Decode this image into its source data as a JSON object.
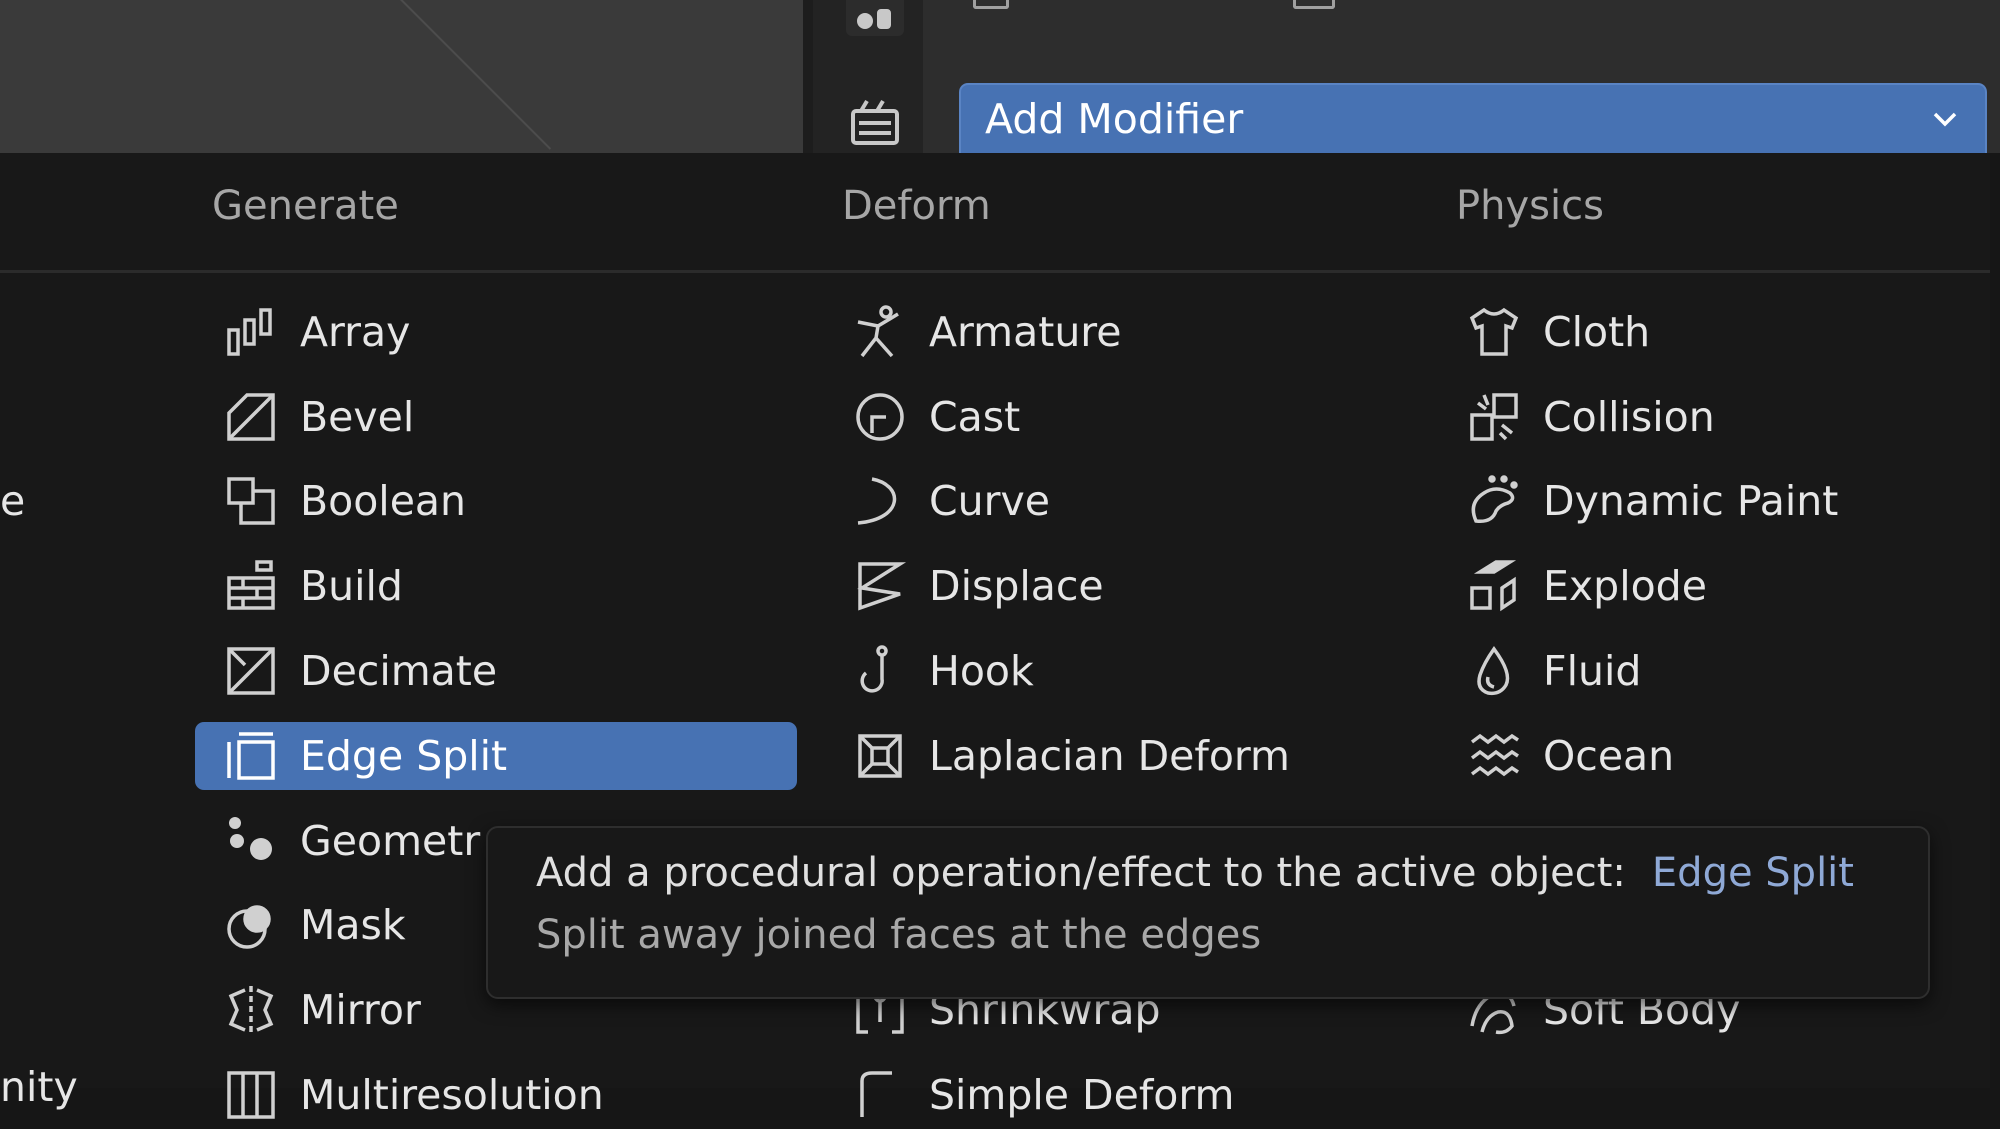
{
  "properties": {
    "add_modifier_label": "Add Modifier"
  },
  "menu": {
    "columns": [
      {
        "heading": "Generate",
        "items": [
          {
            "label": "Array",
            "icon": "array-icon"
          },
          {
            "label": "Bevel",
            "icon": "bevel-icon"
          },
          {
            "label": "Boolean",
            "icon": "boolean-icon"
          },
          {
            "label": "Build",
            "icon": "build-icon"
          },
          {
            "label": "Decimate",
            "icon": "decimate-icon"
          },
          {
            "label": "Edge Split",
            "icon": "edge-split-icon",
            "selected": true
          },
          {
            "label": "Geometr",
            "icon": "geometry-nodes-icon"
          },
          {
            "label": "Mask",
            "icon": "mask-icon"
          },
          {
            "label": "Mirror",
            "icon": "mirror-icon"
          },
          {
            "label": "Multiresolution",
            "icon": "multiresolution-icon"
          }
        ]
      },
      {
        "heading": "Deform",
        "items": [
          {
            "label": "Armature",
            "icon": "armature-icon"
          },
          {
            "label": "Cast",
            "icon": "cast-icon"
          },
          {
            "label": "Curve",
            "icon": "curve-icon"
          },
          {
            "label": "Displace",
            "icon": "displace-icon"
          },
          {
            "label": "Hook",
            "icon": "hook-icon"
          },
          {
            "label": "Laplacian Deform",
            "icon": "laplacian-deform-icon"
          },
          {
            "label": "Shrinkwrap",
            "icon": "shrinkwrap-icon"
          },
          {
            "label": "Simple Deform",
            "icon": "simple-deform-icon"
          }
        ]
      },
      {
        "heading": "Physics",
        "items": [
          {
            "label": "Cloth",
            "icon": "cloth-icon"
          },
          {
            "label": "Collision",
            "icon": "collision-icon"
          },
          {
            "label": "Dynamic Paint",
            "icon": "dynamic-paint-icon"
          },
          {
            "label": "Explode",
            "icon": "explode-icon"
          },
          {
            "label": "Fluid",
            "icon": "fluid-icon"
          },
          {
            "label": "Ocean",
            "icon": "ocean-icon"
          },
          {
            "label": "Soft Body",
            "icon": "soft-body-icon"
          }
        ]
      }
    ],
    "left_fragments": [
      "e",
      "nity"
    ]
  },
  "tooltip": {
    "description": "Add a procedural operation/effect to the active object:",
    "highlight": "Edge Split",
    "detail": "Split away joined faces at the edges"
  },
  "colors": {
    "accent": "#4772b3",
    "menu_bg": "#181818",
    "tooltip_highlight": "#8fa9d6"
  }
}
